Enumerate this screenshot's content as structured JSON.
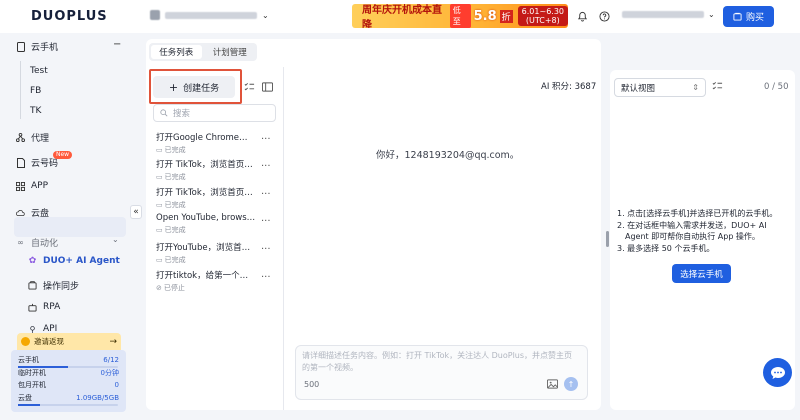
{
  "brand": {
    "logo": "DUOPLUS"
  },
  "promo": {
    "title": "周年庆开机成本直降",
    "tag": "低至",
    "discount": "5.8",
    "unit": "折",
    "dates": "6.01~6.30",
    "tz": "(UTC+8)"
  },
  "header": {
    "buy_label": "购买"
  },
  "sidebar": {
    "cloud_phone": "云手机",
    "groups": [
      "Test",
      "FB",
      "TK"
    ],
    "proxy": "代理",
    "cloud_number": "云号码",
    "new_badge": "New",
    "app": "APP",
    "cloud_disk": "云盘",
    "automation": "自动化",
    "agent": "DUO+ AI Agent",
    "sync": "操作同步",
    "rpa": "RPA",
    "api": "API",
    "collapse": "«",
    "invite": "邀请返现",
    "invite_arrow": "→",
    "quota": [
      {
        "label": "云手机",
        "value": "6/12",
        "fill": 0.5
      },
      {
        "label": "临时开机",
        "value": "0分钟",
        "fill": 0
      },
      {
        "label": "包月开机",
        "value": "0",
        "fill": 0
      },
      {
        "label": "云盘",
        "value": "1.09GB/5GB",
        "fill": 0.22
      }
    ]
  },
  "tabs": {
    "task_list": "任务列表",
    "plan": "计划管理"
  },
  "tasks": {
    "create_label": "创建任务",
    "search_placeholder": "搜索",
    "more": "···",
    "items": [
      {
        "title": "打开Google Chrome，搜...",
        "status": "已完成"
      },
      {
        "title": "打开 TikTok，浏览首页推...",
        "status": "已完成"
      },
      {
        "title": "打开 TikTok，浏览首页推...",
        "status": "已完成"
      },
      {
        "title": "Open YouTube, browse t...",
        "status": "已完成"
      },
      {
        "title": "打开YouTube，浏览首页...",
        "status": "已完成"
      },
      {
        "title": "打开tiktok，给第一个视频...",
        "status": "已停止"
      }
    ]
  },
  "chat": {
    "points": "AI 积分: 3687",
    "greeting": "你好，1248193204@qq.com。",
    "input_placeholder": "请详细描述任务内容。例如：打开 TikTok，关注达人 DuoPlus，并点赞主页的第一个视频。",
    "char_limit": "500"
  },
  "right": {
    "view": "默认视图",
    "count": "0 / 50",
    "instructions": [
      "1. 点击[选择云手机]并选择已开机的云手机。",
      "2. 在对话框中输入需求并发送，DUO+ AI Agent 即可帮你自动执行 App 操作。",
      "3. 最多选择 50 个云手机。"
    ],
    "select_button": "选择云手机"
  },
  "colors": {
    "primary": "#1f5fe0",
    "highlight": "#e0533a",
    "sidebar_bg": "#f3f5f9"
  }
}
